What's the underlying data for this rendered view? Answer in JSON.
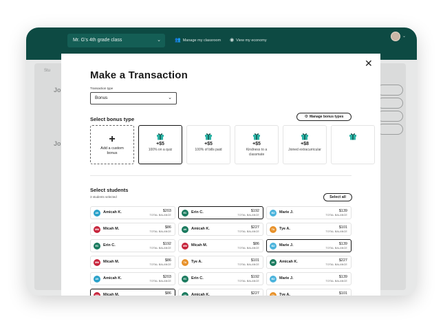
{
  "app": {
    "class_name": "Mr. G's 4th grade class",
    "nav_manage": "Manage my classroom",
    "nav_economy": "View my economy"
  },
  "background": {
    "tab_fragment": "Stu",
    "heading_fragment": "Jo",
    "heading_fragment_2": "Jo"
  },
  "modal": {
    "title": "Make a Transaction",
    "close_icon": "close-icon",
    "transaction_type_label": "Transaction type",
    "transaction_type_value": "Bonus",
    "select_bonus_title": "Select bonus type",
    "manage_bonus_label": "Manage bonus types",
    "custom_bonus_label": "Add a custom bonus",
    "bonus_cards": [
      {
        "amount": "+$5",
        "desc": "100% on a quiz",
        "selected": true
      },
      {
        "amount": "+$5",
        "desc": "100% of bills paid",
        "selected": false
      },
      {
        "amount": "+$5",
        "desc": "Kindness to a classmate",
        "selected": false
      },
      {
        "amount": "+$8",
        "desc": "Joined extracurricular",
        "selected": false
      }
    ],
    "select_students_title": "Select students",
    "selected_count": "3 students selected",
    "select_all_label": "Select all",
    "balance_label": "TOTAL BALANCE"
  },
  "students": [
    {
      "initials": "AK",
      "name": "Amicah K.",
      "amount": "$203",
      "color": "#2aa1c9",
      "selected": false
    },
    {
      "initials": "EC",
      "name": "Erin C.",
      "amount": "$192",
      "color": "#1a7a5e",
      "selected": true
    },
    {
      "initials": "MJ",
      "name": "Marie J.",
      "amount": "$139",
      "color": "#4ab3dc",
      "selected": false
    },
    {
      "initials": "MM",
      "name": "Micah M.",
      "amount": "$86",
      "color": "#c7253c",
      "selected": false
    },
    {
      "initials": "AK",
      "name": "Amicah K.",
      "amount": "$227",
      "color": "#1a7a5e",
      "selected": false
    },
    {
      "initials": "TA",
      "name": "Tye A.",
      "amount": "$101",
      "color": "#e8922b",
      "selected": false
    },
    {
      "initials": "EC",
      "name": "Erin C.",
      "amount": "$192",
      "color": "#1a7a5e",
      "selected": false
    },
    {
      "initials": "MM",
      "name": "Micah M.",
      "amount": "$86",
      "color": "#c7253c",
      "selected": false
    },
    {
      "initials": "MJ",
      "name": "Marie J.",
      "amount": "$139",
      "color": "#4ab3dc",
      "selected": true
    },
    {
      "initials": "MM",
      "name": "Micah M.",
      "amount": "$86",
      "color": "#c7253c",
      "selected": false
    },
    {
      "initials": "TA",
      "name": "Tye A.",
      "amount": "$101",
      "color": "#e8922b",
      "selected": false
    },
    {
      "initials": "AK",
      "name": "Amicah K.",
      "amount": "$227",
      "color": "#1a7a5e",
      "selected": false
    },
    {
      "initials": "AK",
      "name": "Amicah K.",
      "amount": "$203",
      "color": "#2aa1c9",
      "selected": false
    },
    {
      "initials": "EC",
      "name": "Erin C.",
      "amount": "$192",
      "color": "#1a7a5e",
      "selected": false
    },
    {
      "initials": "MJ",
      "name": "Marie J.",
      "amount": "$139",
      "color": "#4ab3dc",
      "selected": false
    },
    {
      "initials": "MM",
      "name": "Micah M.",
      "amount": "$86",
      "color": "#c7253c",
      "selected": true
    },
    {
      "initials": "AK",
      "name": "Amicah K.",
      "amount": "$227",
      "color": "#1a7a5e",
      "selected": false
    },
    {
      "initials": "TA",
      "name": "Tye A.",
      "amount": "$101",
      "color": "#e8922b",
      "selected": false
    }
  ]
}
